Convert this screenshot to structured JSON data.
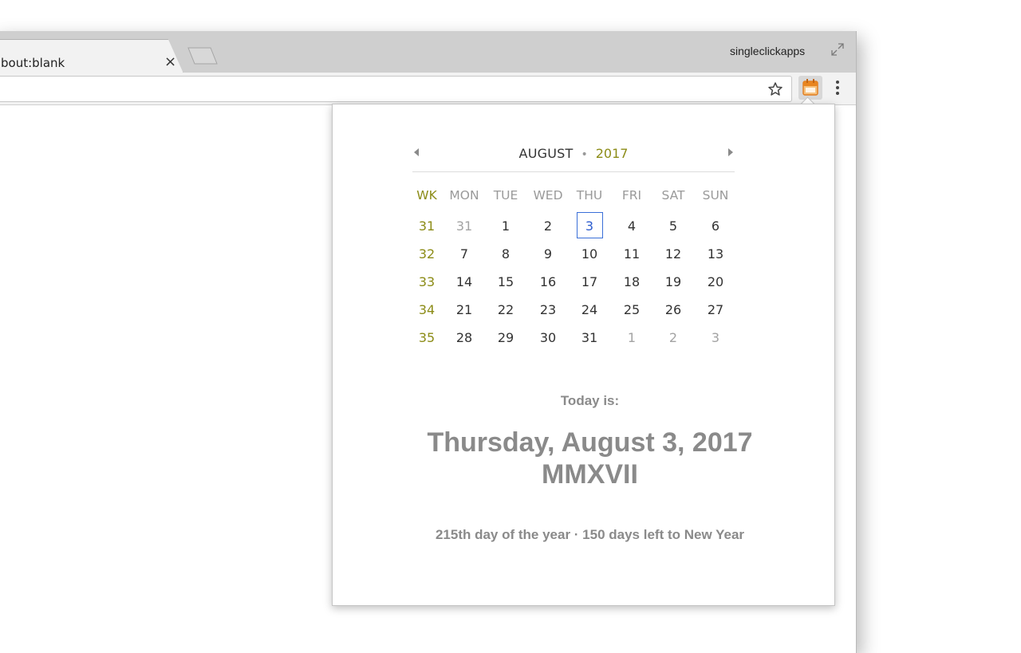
{
  "browser": {
    "tab_title": "bout:blank",
    "tab_close": "×",
    "profile_name": "singleclickapps"
  },
  "calendar": {
    "month": "AUGUST",
    "separator": "•",
    "year": "2017",
    "headers": [
      "WK",
      "MON",
      "TUE",
      "WED",
      "THU",
      "FRI",
      "SAT",
      "SUN"
    ],
    "weeks": [
      {
        "wk": "31",
        "days": [
          "31",
          "1",
          "2",
          "3",
          "4",
          "5",
          "6"
        ]
      },
      {
        "wk": "32",
        "days": [
          "7",
          "8",
          "9",
          "10",
          "11",
          "12",
          "13"
        ]
      },
      {
        "wk": "33",
        "days": [
          "14",
          "15",
          "16",
          "17",
          "18",
          "19",
          "20"
        ]
      },
      {
        "wk": "34",
        "days": [
          "21",
          "22",
          "23",
          "24",
          "25",
          "26",
          "27"
        ]
      },
      {
        "wk": "35",
        "days": [
          "28",
          "29",
          "30",
          "31",
          "1",
          "2",
          "3"
        ]
      }
    ],
    "today_day": "3",
    "colors": {
      "week_number": "#8c8c17",
      "today_border": "#3a6fd8",
      "other_month": "#a3a3a3"
    }
  },
  "info": {
    "today_label": "Today is:",
    "today_date": "Thursday, August 3, 2017",
    "roman_year": "MMXVII",
    "year_progress": "215th day of the year · 150 days left to New Year"
  }
}
